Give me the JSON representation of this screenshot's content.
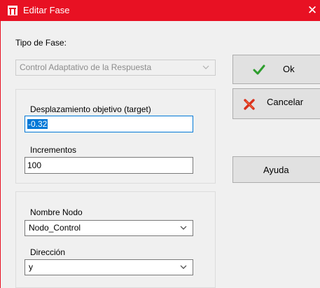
{
  "window": {
    "title": "Editar Fase",
    "close_glyph": "✕",
    "accent_color": "#e81123",
    "app_icon": "window-app-icon"
  },
  "phase_type": {
    "label": "Tipo de Fase:",
    "value": "Control Adaptativo de la Respuesta",
    "disabled": true
  },
  "target_group": {
    "displacement_label": "Desplazamiento objetivo (target)",
    "displacement_value": "-0.32",
    "increments_label": "Incrementos",
    "increments_value": "100"
  },
  "node_group": {
    "node_name_label": "Nombre Nodo",
    "node_name_value": "Nodo_Control",
    "direction_label": "Dirección",
    "direction_value": "y"
  },
  "buttons": {
    "ok_label": "Ok",
    "ok_icon": "checkmark-icon",
    "cancel_label": "Cancelar",
    "cancel_icon": "red-x-icon",
    "help_label": "Ayuda"
  }
}
